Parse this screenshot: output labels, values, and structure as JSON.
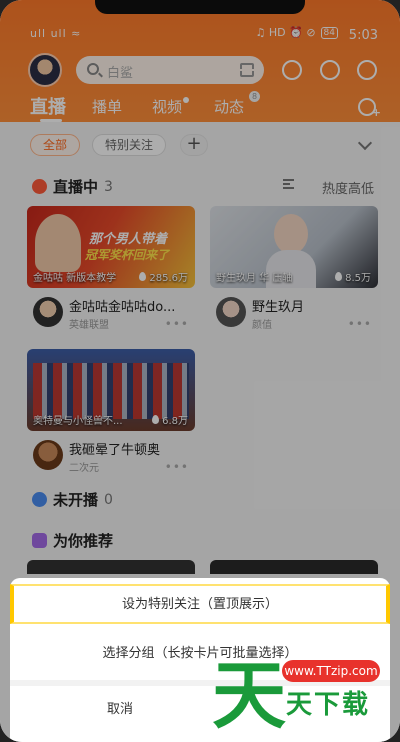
{
  "status_bar": {
    "time": "5:03",
    "left": "ull ull ≈",
    "right_icons": "♫ HD ⏰ ⊘",
    "battery": "84"
  },
  "header": {
    "search_placeholder": "白鲨",
    "tabs": [
      {
        "label": "直播",
        "active": true
      },
      {
        "label": "播单"
      },
      {
        "label": "视频"
      },
      {
        "label": "动态",
        "badge": "8"
      }
    ]
  },
  "filters": {
    "chips": [
      "全部",
      "特别关注"
    ],
    "add": "+"
  },
  "live_section": {
    "title": "直播中",
    "count": "3",
    "sort_label": "热度高低"
  },
  "cards": [
    {
      "caption": "金咕咕 新版本教学",
      "views": "285.6万",
      "title": "金咕咕金咕咕do...",
      "sub": "英雄联盟",
      "more": "•••",
      "banner1": "那个男人带着",
      "banner2": "冠军奖杯回来了"
    },
    {
      "caption": "野生玖月 华 压轴",
      "views": "8.5万",
      "title": "野生玖月",
      "sub": "颜值",
      "more": "•••"
    },
    {
      "caption": "奥特曼与小怪兽不...",
      "views": "6.8万",
      "title": "我砸晕了牛顿奥",
      "sub": "二次元",
      "more": "•••"
    }
  ],
  "offline_section": {
    "title": "未开播",
    "count": "0"
  },
  "recommend_section": {
    "title": "为你推荐"
  },
  "sheet": {
    "option1": "设为特别关注（置顶展示）",
    "option2": "选择分组（长按卡片可批量选择）",
    "cancel": "取消"
  },
  "watermark": {
    "big": "天",
    "url": "www.TTzip.com",
    "text": "天下载"
  },
  "colors": {
    "accent": "#ff7a2a",
    "watermark_green": "#1a9a3a",
    "highlight": "#ffc800"
  }
}
